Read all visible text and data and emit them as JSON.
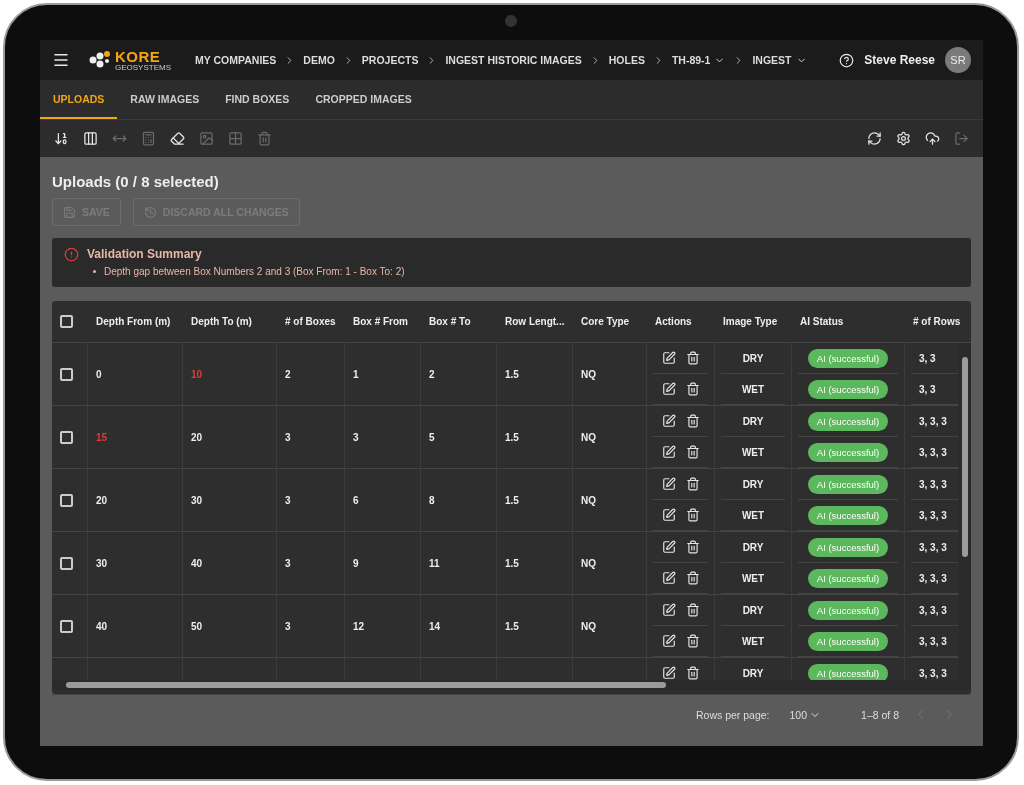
{
  "app_bar": {
    "logo": {
      "name": "KORE",
      "tagline": "GEOSYSTEMS"
    },
    "breadcrumbs": [
      {
        "label": "MY COMPANIES",
        "has_menu": false
      },
      {
        "label": "DEMO",
        "has_menu": false
      },
      {
        "label": "PROJECTS",
        "has_menu": false
      },
      {
        "label": "INGEST HISTORIC IMAGES",
        "has_menu": false
      },
      {
        "label": "HOLES",
        "has_menu": false
      },
      {
        "label": "TH-89-1",
        "has_menu": true
      },
      {
        "label": "INGEST",
        "has_menu": true
      }
    ],
    "user": {
      "name": "Steve Reese",
      "initials": "SR"
    }
  },
  "tabs": [
    {
      "label": "UPLOADS",
      "selected": true
    },
    {
      "label": "RAW IMAGES",
      "selected": false
    },
    {
      "label": "FIND BOXES",
      "selected": false
    },
    {
      "label": "CROPPED IMAGES",
      "selected": false
    }
  ],
  "toolbar": {
    "left": [
      {
        "kind": "sort",
        "disabled": false
      },
      {
        "kind": "columns",
        "disabled": false
      },
      {
        "kind": "fit-width",
        "disabled": true
      },
      {
        "kind": "calculator",
        "disabled": true
      },
      {
        "kind": "eraser",
        "disabled": false
      },
      {
        "kind": "image",
        "disabled": true
      },
      {
        "kind": "grid",
        "disabled": true
      },
      {
        "kind": "delete",
        "disabled": true
      }
    ],
    "right": [
      {
        "kind": "refresh",
        "disabled": false
      },
      {
        "kind": "settings",
        "disabled": false
      },
      {
        "kind": "upload",
        "disabled": false
      },
      {
        "kind": "exit",
        "disabled": true
      }
    ]
  },
  "title": "Uploads (0 / 8 selected)",
  "buttons": [
    {
      "kind": "save",
      "label": "SAVE",
      "disabled": true
    },
    {
      "kind": "discard",
      "label": "DISCARD ALL CHANGES",
      "disabled": true
    }
  ],
  "validation": {
    "title": "Validation Summary",
    "items": [
      "Depth gap between Box Numbers 2 and 3 (Box From: 1 - Box To: 2)"
    ]
  },
  "table": {
    "select_all": {
      "checked": false
    },
    "columns": [
      "Depth From (m)",
      "Depth To (m)",
      "# of Boxes",
      "Box # From",
      "Box # To",
      "Row Lengt...",
      "Core Type",
      "Actions",
      "Image Type",
      "AI Status",
      "# of Rows"
    ],
    "rows": [
      {
        "checked": false,
        "depth_from": "0",
        "depth_from_invalid": false,
        "depth_to": "10",
        "depth_to_invalid": true,
        "boxes": "2",
        "box_from": "1",
        "box_to": "2",
        "row_length": "1.5",
        "core_type": "NQ",
        "images": [
          {
            "type": "DRY",
            "status": "AI (successful)",
            "rows": "3, 3"
          },
          {
            "type": "WET",
            "status": "AI (successful)",
            "rows": "3, 3"
          }
        ]
      },
      {
        "checked": false,
        "depth_from": "15",
        "depth_from_invalid": true,
        "depth_to": "20",
        "depth_to_invalid": false,
        "boxes": "3",
        "box_from": "3",
        "box_to": "5",
        "row_length": "1.5",
        "core_type": "NQ",
        "images": [
          {
            "type": "DRY",
            "status": "AI (successful)",
            "rows": "3, 3, 3"
          },
          {
            "type": "WET",
            "status": "AI (successful)",
            "rows": "3, 3, 3"
          }
        ]
      },
      {
        "checked": false,
        "depth_from": "20",
        "depth_from_invalid": false,
        "depth_to": "30",
        "depth_to_invalid": false,
        "boxes": "3",
        "box_from": "6",
        "box_to": "8",
        "row_length": "1.5",
        "core_type": "NQ",
        "images": [
          {
            "type": "DRY",
            "status": "AI (successful)",
            "rows": "3, 3, 3"
          },
          {
            "type": "WET",
            "status": "AI (successful)",
            "rows": "3, 3, 3"
          }
        ]
      },
      {
        "checked": false,
        "depth_from": "30",
        "depth_from_invalid": false,
        "depth_to": "40",
        "depth_to_invalid": false,
        "boxes": "3",
        "box_from": "9",
        "box_to": "11",
        "row_length": "1.5",
        "core_type": "NQ",
        "images": [
          {
            "type": "DRY",
            "status": "AI (successful)",
            "rows": "3, 3, 3"
          },
          {
            "type": "WET",
            "status": "AI (successful)",
            "rows": "3, 3, 3"
          }
        ]
      },
      {
        "checked": false,
        "depth_from": "40",
        "depth_from_invalid": false,
        "depth_to": "50",
        "depth_to_invalid": false,
        "boxes": "3",
        "box_from": "12",
        "box_to": "14",
        "row_length": "1.5",
        "core_type": "NQ",
        "images": [
          {
            "type": "DRY",
            "status": "AI (successful)",
            "rows": "3, 3, 3"
          },
          {
            "type": "WET",
            "status": "AI (successful)",
            "rows": "3, 3, 3"
          }
        ]
      },
      {
        "images": [
          {
            "type": "DRY",
            "status": "AI (successful)",
            "rows": "3, 3, 3"
          }
        ]
      }
    ]
  },
  "pagination": {
    "rows_label": "Rows per page:",
    "rows_value": "100",
    "range": "1–8 of 8",
    "prev_disabled": true,
    "next_disabled": true
  }
}
